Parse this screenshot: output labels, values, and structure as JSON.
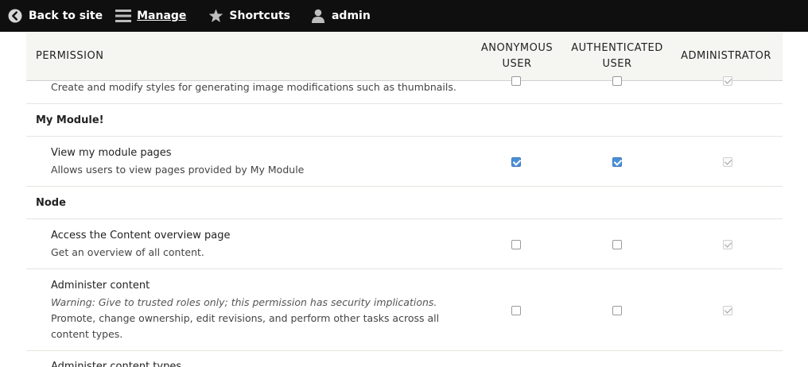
{
  "toolbar": {
    "back_label": "Back to site",
    "manage_label": "Manage",
    "shortcuts_label": "Shortcuts",
    "user_label": "admin"
  },
  "table": {
    "headers": {
      "permission": "PERMISSION",
      "anonymous_line1": "ANONYMOUS",
      "anonymous_line2": "USER",
      "authenticated_line1": "AUTHENTICATED",
      "authenticated_line2": "USER",
      "administrator": "ADMINISTRATOR"
    },
    "rows": [
      {
        "description": "Create and modify styles for generating image modifications such as thumbnails.",
        "anonymous": false,
        "authenticated": false,
        "administrator": true
      },
      {
        "module": "My Module!"
      },
      {
        "title": "View my module pages",
        "description": "Allows users to view pages provided by My Module",
        "anonymous": true,
        "authenticated": true,
        "administrator": true
      },
      {
        "module": "Node"
      },
      {
        "title": "Access the Content overview page",
        "description": "Get an overview of all content.",
        "anonymous": false,
        "authenticated": false,
        "administrator": true
      },
      {
        "title": "Administer content",
        "warning": "Warning: Give to trusted roles only; this permission has security implications.",
        "description_line1": "Promote, change ownership, edit revisions, and perform other tasks across all",
        "description_line2": "content types.",
        "anonymous": false,
        "authenticated": false,
        "administrator": true
      },
      {
        "title": "Administer content types"
      }
    ]
  }
}
